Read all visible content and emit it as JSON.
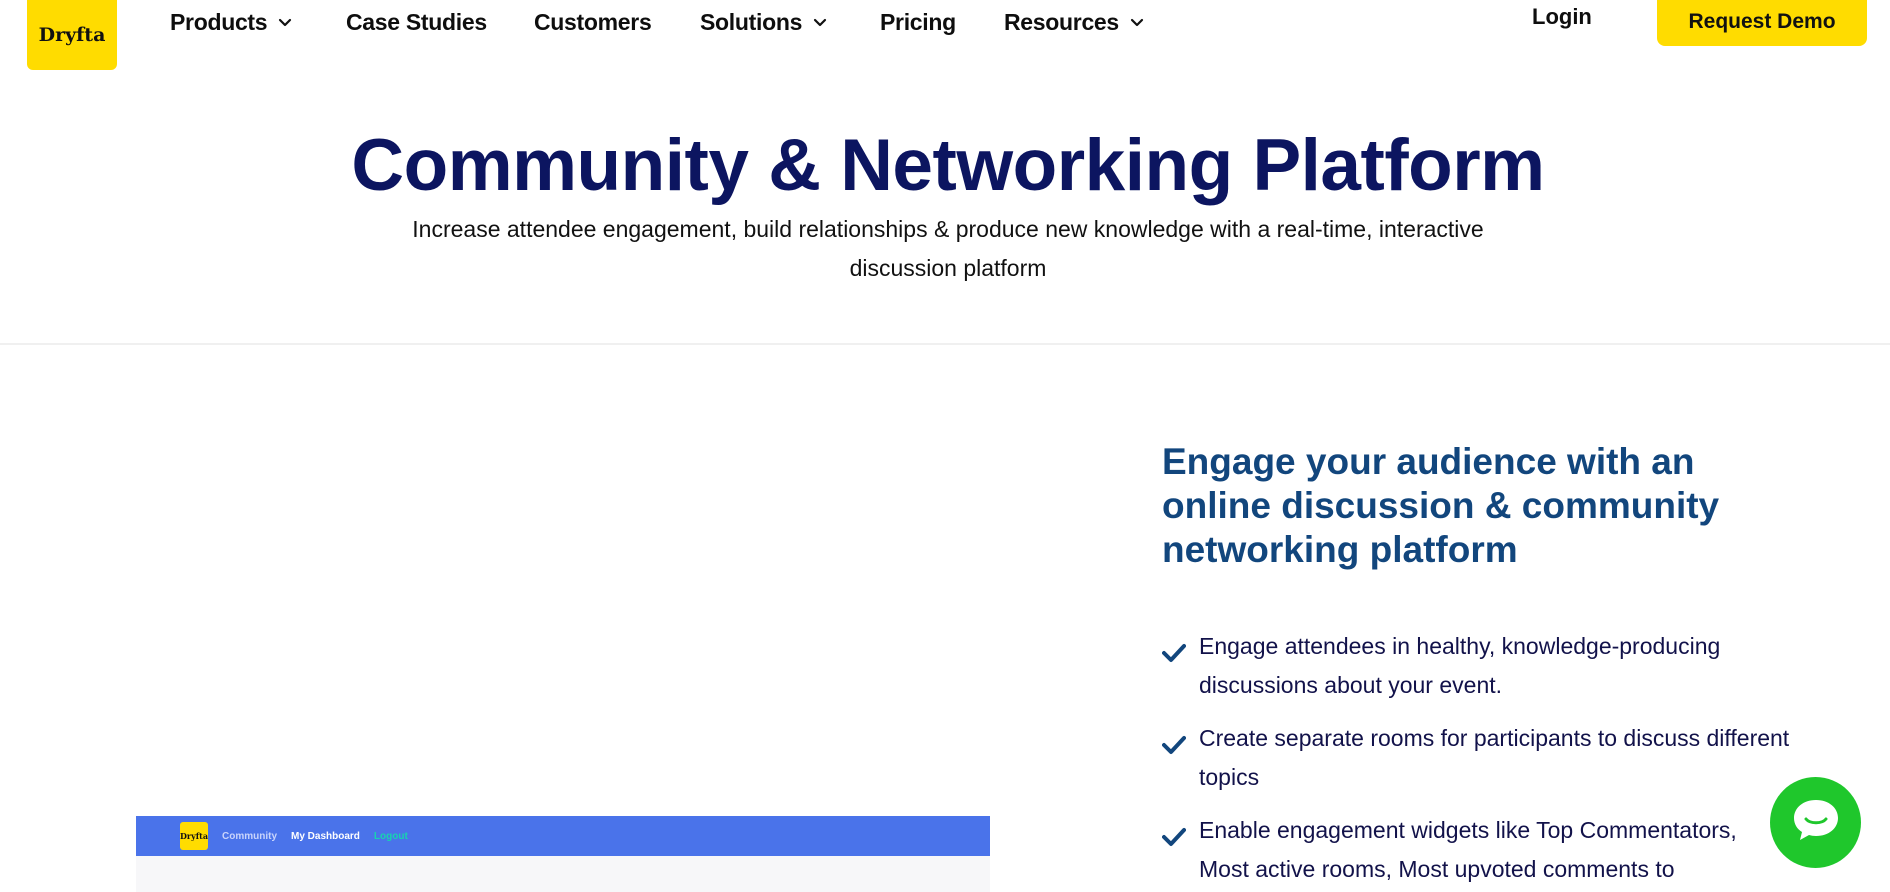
{
  "nav": {
    "logo_text": "Dryfta",
    "items": [
      {
        "label": "Products",
        "has_dropdown": true
      },
      {
        "label": "Case Studies",
        "has_dropdown": false
      },
      {
        "label": "Customers",
        "has_dropdown": false
      },
      {
        "label": "Solutions",
        "has_dropdown": true
      },
      {
        "label": "Pricing",
        "has_dropdown": false
      },
      {
        "label": "Resources",
        "has_dropdown": true
      }
    ],
    "login_label": "Login",
    "demo_label": "Request Demo"
  },
  "hero": {
    "title": "Community & Networking Platform",
    "subtitle": "Increase attendee engagement, build relationships & produce new knowledge with a real-time, interactive discussion platform"
  },
  "preview": {
    "logo_text": "Dryfta",
    "links": [
      "Community",
      "My Dashboard",
      "Logout"
    ]
  },
  "feature": {
    "heading": "Engage your audience with an online discussion & community networking platform",
    "items": [
      "Engage attendees in healthy, knowledge-producing discussions about your event.",
      "Create separate rooms for participants to discuss different topics",
      "Enable engagement widgets like Top Commentators, Most active rooms, Most upvoted comments to"
    ]
  },
  "colors": {
    "brand_yellow": "#ffdc00",
    "title_navy": "#0c1560",
    "feature_blue": "#12467d",
    "preview_bar_blue": "#4a73ea",
    "chat_green": "#1fc72c"
  },
  "icons": {
    "dropdown": "chevron-down-icon",
    "bullet": "check-icon",
    "chat": "chat-bubble-icon"
  }
}
